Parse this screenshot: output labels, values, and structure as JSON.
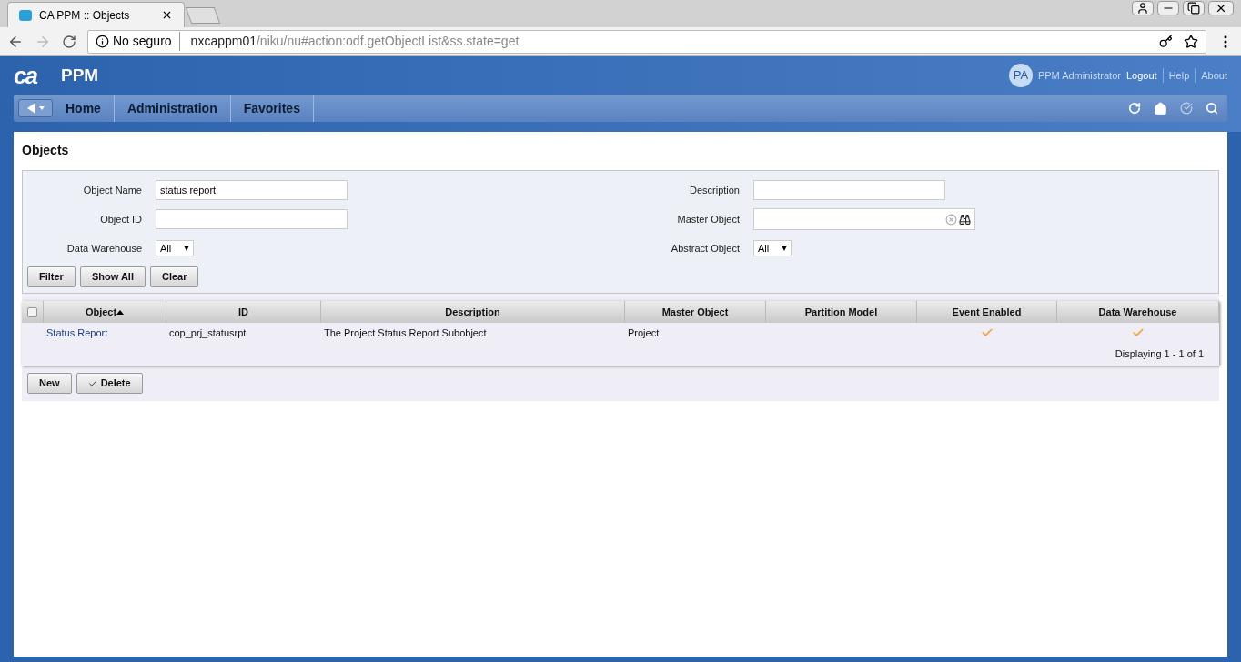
{
  "browser": {
    "tab_title": "CA PPM :: Objects",
    "security": "No seguro",
    "host": "nxcappm01",
    "path": "/niku/nu#action:odf.getObjectList&ss.state=get"
  },
  "app": {
    "logo": "ca",
    "title": "PPM",
    "user": {
      "initials": "PA",
      "name": "PPM Administrator"
    },
    "links": [
      "Logout",
      "Help",
      "About"
    ]
  },
  "nav": {
    "items": [
      "Home",
      "Administration",
      "Favorites"
    ]
  },
  "page_title": "Objects",
  "filter": {
    "left": [
      {
        "kind": "text",
        "label": "Object Name",
        "value": "status report"
      },
      {
        "kind": "text",
        "label": "Object ID"
      },
      {
        "kind": "select",
        "label": "Data Warehouse",
        "value": "All"
      }
    ],
    "right": [
      {
        "kind": "text",
        "label": "Description"
      },
      {
        "kind": "lookup",
        "label": "Master Object"
      },
      {
        "kind": "select",
        "label": "Abstract Object",
        "value": "All"
      }
    ],
    "buttons": [
      "Filter",
      "Show All",
      "Clear"
    ]
  },
  "table": {
    "select_all_checked": false,
    "columns": [
      {
        "label": "Object",
        "sorted": true
      },
      {
        "label": "ID",
        "sorted": false
      },
      {
        "label": "Description",
        "sorted": false
      },
      {
        "label": "Master Object",
        "sorted": false
      },
      {
        "label": "Partition Model",
        "sorted": false
      },
      {
        "label": "Event Enabled",
        "sorted": false
      },
      {
        "label": "Data Warehouse",
        "sorted": false
      }
    ],
    "rows": [
      {
        "object": "Status Report",
        "id": "cop_prj_statusrpt",
        "description": "The Project Status Report Subobject",
        "master_object": "Project",
        "event_enabled": true,
        "data_warehouse": true
      }
    ],
    "footer": "Displaying 1 - 1 of 1"
  },
  "actions": [
    {
      "kind": "plain",
      "label": "New"
    },
    {
      "kind": "check",
      "label": "Delete"
    }
  ]
}
